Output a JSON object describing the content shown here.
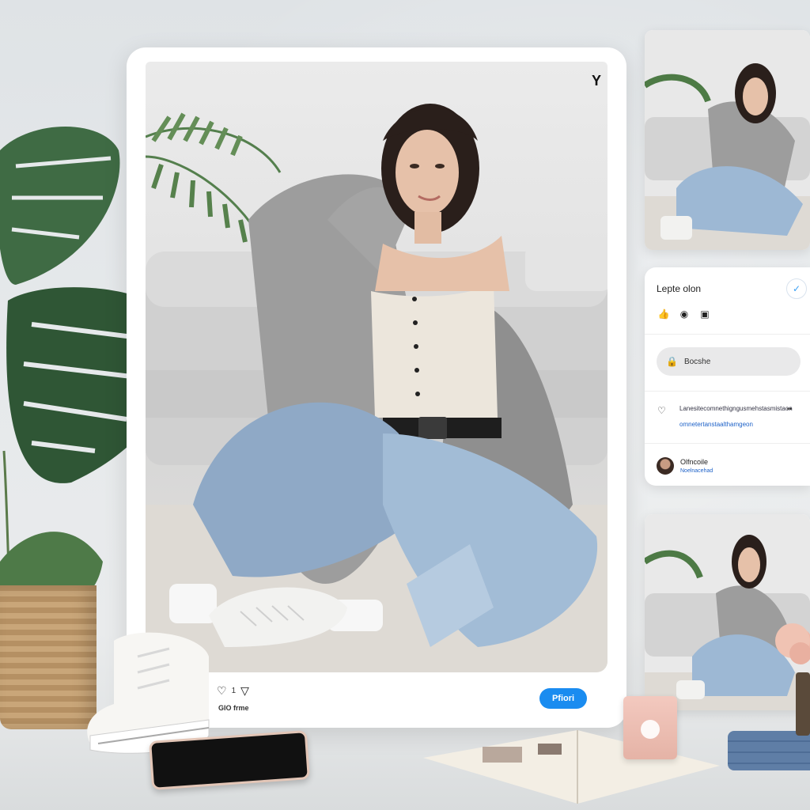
{
  "post": {
    "menu_glyph": "Y",
    "like_icon": "heart-outline-icon",
    "share_icon": "send-icon",
    "like_count": "1",
    "caption": "GIO frme",
    "post_button": "Pfiori"
  },
  "panel": {
    "title": "Lepte olon",
    "badge_icon": "shield-check-icon",
    "icons": [
      "thumbs-up-icon",
      "circle-icon",
      "message-icon"
    ],
    "search_icon": "bag-icon",
    "search_text": "Bocshe",
    "comment_icon": "heart-outline-icon",
    "comment_line1": "Lanesitecomnethigngusmehstasmistaon",
    "comment_line2": "omnetertanstaalthamgeon",
    "comment_dots": "••",
    "user_name": "Olfncoile",
    "user_sub": "Noelnacehad"
  },
  "colors": {
    "accent": "#1a8cf0",
    "card": "#ffffff",
    "background": "#e6e9eb"
  }
}
